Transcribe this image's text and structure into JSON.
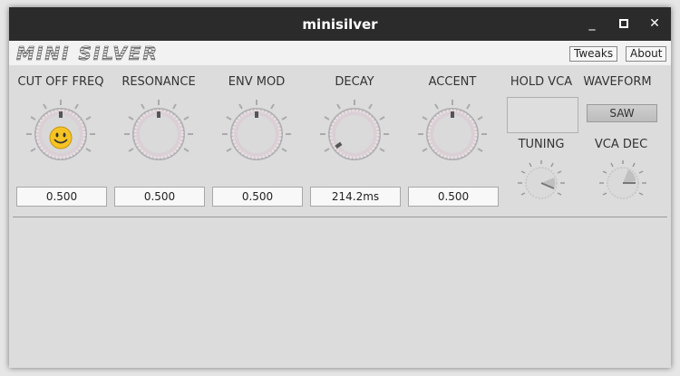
{
  "window": {
    "title": "minisilver"
  },
  "toolbar": {
    "logo_text": "MINI SILVER",
    "tweaks_label": "Tweaks",
    "about_label": "About"
  },
  "knobs": [
    {
      "label": "CUT OFF FREQ",
      "value": "0.500"
    },
    {
      "label": "RESONANCE",
      "value": "0.500"
    },
    {
      "label": "ENV MOD",
      "value": "0.500"
    },
    {
      "label": "DECAY",
      "value": "214.2ms"
    },
    {
      "label": "ACCENT",
      "value": "0.500"
    }
  ],
  "hold_vca": {
    "label": "HOLD VCA"
  },
  "waveform": {
    "label": "WAVEFORM",
    "value": "SAW"
  },
  "tuning": {
    "label": "TUNING"
  },
  "vca_dec": {
    "label": "VCA DEC"
  },
  "icons": {
    "minimize": "minimize-icon",
    "maximize": "maximize-icon",
    "close": "close-icon",
    "smiley": "smiley-icon"
  }
}
